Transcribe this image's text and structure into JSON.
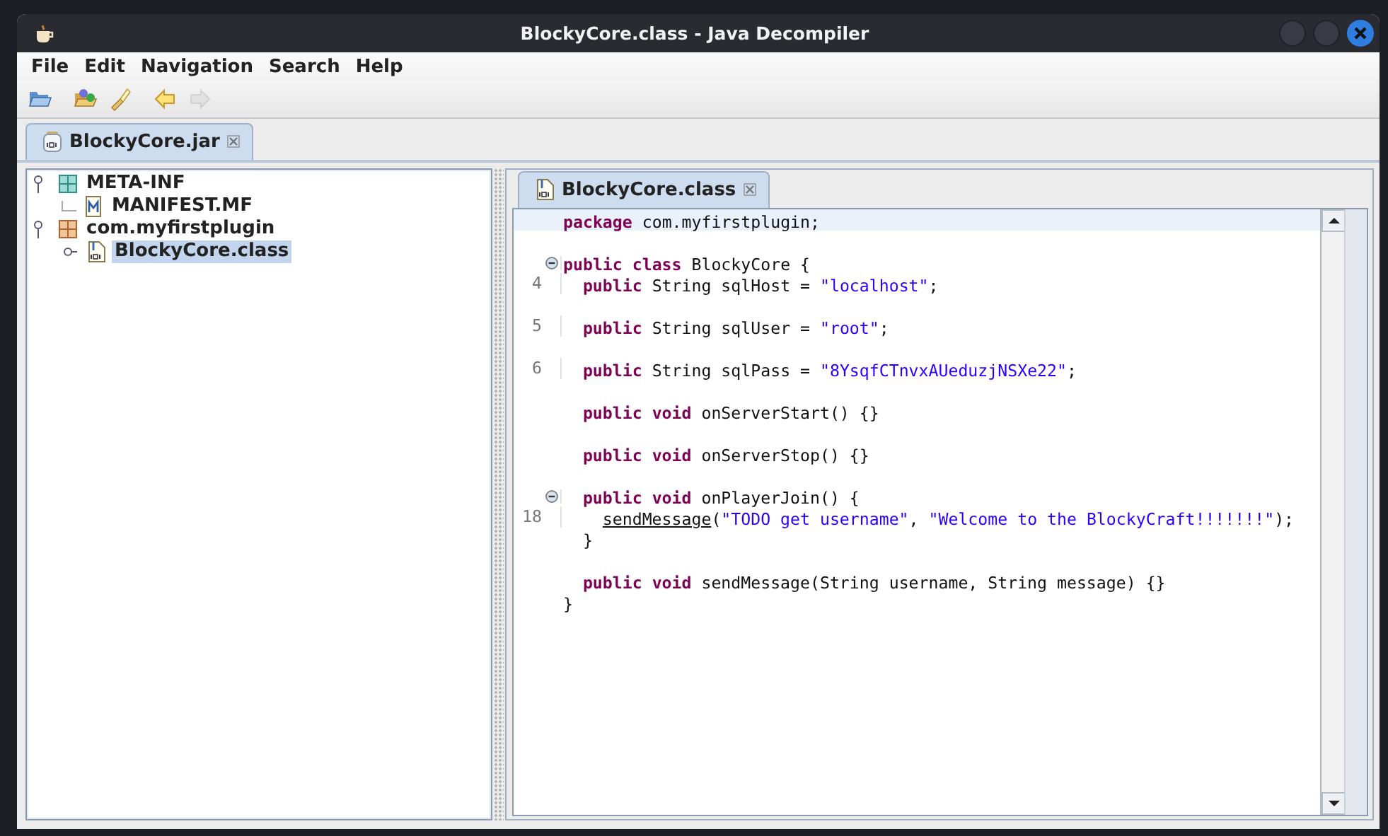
{
  "window": {
    "title": "BlockyCore.class - Java Decompiler"
  },
  "menu": [
    "File",
    "Edit",
    "Navigation",
    "Search",
    "Help"
  ],
  "toolbar": [
    {
      "kind": "open",
      "disabled": false
    },
    {
      "kind": "open-type",
      "disabled": false
    },
    {
      "kind": "search",
      "disabled": false
    },
    {
      "kind": "back",
      "disabled": false
    },
    {
      "kind": "forward",
      "disabled": true
    }
  ],
  "file_tabs": [
    {
      "label": "BlockyCore.jar",
      "selected": true
    }
  ],
  "tree": [
    {
      "label": "META-INF",
      "kind": "folder",
      "selected": false,
      "expanded": true,
      "children": [
        {
          "label": "MANIFEST.MF",
          "kind": "manifest",
          "selected": false
        }
      ]
    },
    {
      "label": "com.myfirstplugin",
      "kind": "package",
      "selected": false,
      "expanded": true,
      "children": [
        {
          "label": "BlockyCore.class",
          "kind": "class",
          "selected": true
        }
      ]
    }
  ],
  "editor_tabs": [
    {
      "label": "BlockyCore.class",
      "selected": true
    }
  ],
  "code": [
    {
      "kind": "code",
      "highlighted": true,
      "tokens": [
        {
          "kind": "keyword",
          "text": "package"
        },
        {
          "kind": "plain",
          "text": " com.myfirstplugin;"
        }
      ]
    },
    {
      "kind": "blank"
    },
    {
      "kind": "code",
      "fold": true,
      "tokens": [
        {
          "kind": "keyword",
          "text": "public class"
        },
        {
          "kind": "plain",
          "text": " BlockyCore {"
        }
      ],
      "children": [
        {
          "kind": "code",
          "number": "4",
          "tokens": [
            {
              "kind": "keyword",
              "text": "public"
            },
            {
              "kind": "plain",
              "text": " String sqlHost = "
            },
            {
              "kind": "string",
              "text": "\"localhost\""
            },
            {
              "kind": "plain",
              "text": ";"
            }
          ]
        },
        {
          "kind": "blank"
        },
        {
          "kind": "code",
          "number": "5",
          "tokens": [
            {
              "kind": "keyword",
              "text": "public"
            },
            {
              "kind": "plain",
              "text": " String sqlUser = "
            },
            {
              "kind": "string",
              "text": "\"root\""
            },
            {
              "kind": "plain",
              "text": ";"
            }
          ]
        },
        {
          "kind": "blank"
        },
        {
          "kind": "code",
          "number": "6",
          "tokens": [
            {
              "kind": "keyword",
              "text": "public"
            },
            {
              "kind": "plain",
              "text": " String sqlPass = "
            },
            {
              "kind": "string",
              "text": "\"8YsqfCTnvxAUeduzjNSXe22\""
            },
            {
              "kind": "plain",
              "text": ";"
            }
          ]
        },
        {
          "kind": "blank"
        },
        {
          "kind": "code",
          "tokens": [
            {
              "kind": "keyword",
              "text": "public void"
            },
            {
              "kind": "plain",
              "text": " onServerStart() {}"
            }
          ]
        },
        {
          "kind": "blank"
        },
        {
          "kind": "code",
          "tokens": [
            {
              "kind": "keyword",
              "text": "public void"
            },
            {
              "kind": "plain",
              "text": " onServerStop() {}"
            }
          ]
        },
        {
          "kind": "blank"
        },
        {
          "kind": "code",
          "fold": true,
          "tokens": [
            {
              "kind": "keyword",
              "text": "public void"
            },
            {
              "kind": "plain",
              "text": " onPlayerJoin() {"
            }
          ],
          "children": [
            {
              "kind": "code",
              "number": "18",
              "tokens": [
                {
                  "kind": "call",
                  "text": "sendMessage"
                },
                {
                  "kind": "plain",
                  "text": "("
                },
                {
                  "kind": "string",
                  "text": "\"TODO get username\""
                },
                {
                  "kind": "plain",
                  "text": ", "
                },
                {
                  "kind": "string",
                  "text": "\"Welcome to the BlockyCraft!!!!!!!\""
                },
                {
                  "kind": "plain",
                  "text": ");"
                }
              ]
            }
          ]
        },
        {
          "kind": "code",
          "tokens": [
            {
              "kind": "plain",
              "text": "}"
            }
          ]
        },
        {
          "kind": "blank"
        },
        {
          "kind": "code",
          "tokens": [
            {
              "kind": "keyword",
              "text": "public void"
            },
            {
              "kind": "plain",
              "text": " sendMessage(String username, String message) {}"
            }
          ]
        }
      ]
    },
    {
      "kind": "code",
      "tokens": [
        {
          "kind": "plain",
          "text": "}"
        }
      ]
    }
  ]
}
